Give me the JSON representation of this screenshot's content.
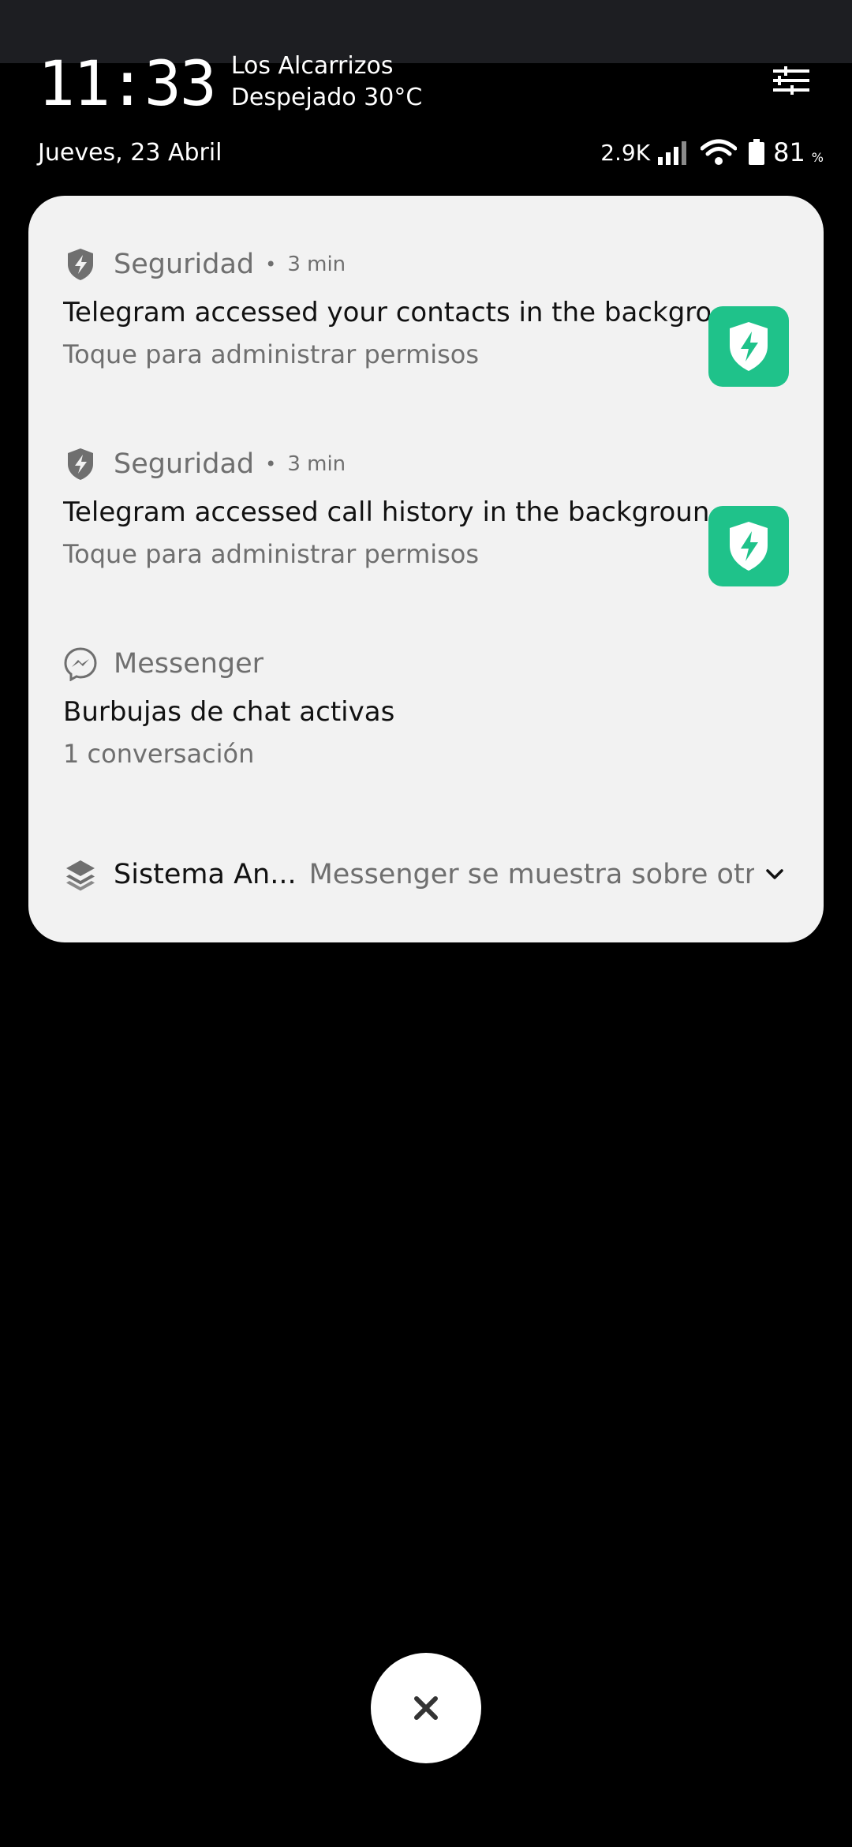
{
  "status": {
    "time": "11:33",
    "location": "Los Alcarrizos",
    "weather": "Despejado 30°C",
    "date": "Jueves, 23 Abril",
    "speed": "2.9K",
    "battery_value": "81",
    "battery_unit": "%"
  },
  "notifications": [
    {
      "app": "Seguridad",
      "time": "3 min",
      "title": "Telegram accessed your contacts in the backgrou..",
      "subtitle": "Toque para administrar permisos",
      "icon": "shield-bolt-icon"
    },
    {
      "app": "Seguridad",
      "time": "3 min",
      "title": "Telegram accessed call history in the background",
      "subtitle": "Toque para administrar permisos",
      "icon": "shield-bolt-icon"
    },
    {
      "app": "Messenger",
      "title": "Burbujas de chat activas",
      "subtitle": "1 conversación",
      "icon": "messenger-icon"
    }
  ],
  "summary": {
    "app": "Sistema An...",
    "text": "Messenger se muestra sobre otras ap...",
    "icon": "layers-icon"
  },
  "colors": {
    "accent_green": "#1fc28a",
    "panel_bg": "#f2f2f2",
    "background": "#000000"
  }
}
